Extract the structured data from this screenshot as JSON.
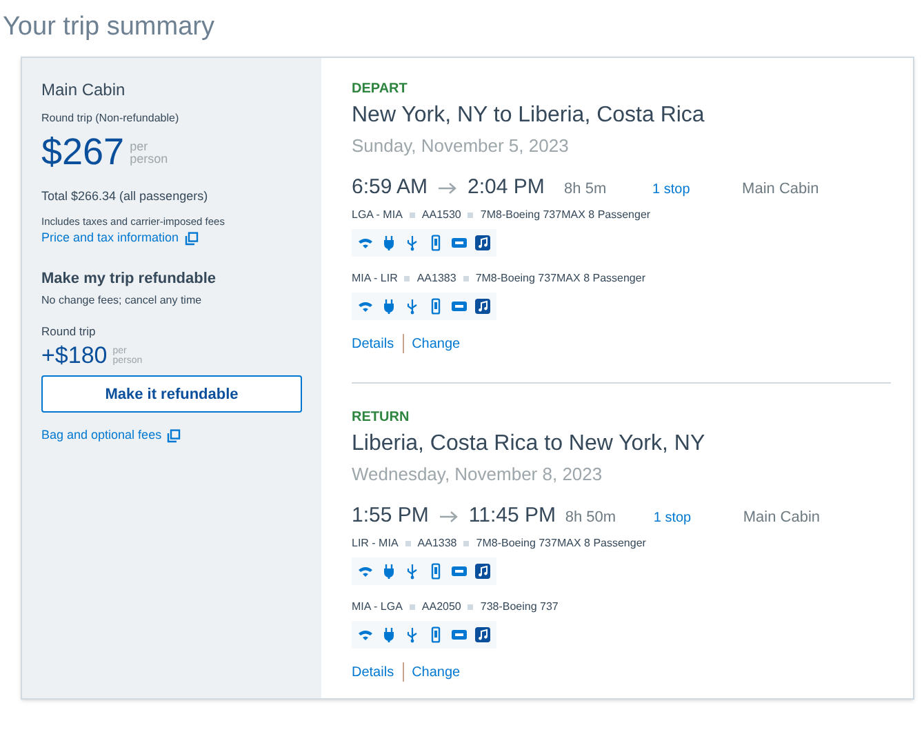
{
  "title": "Your trip summary",
  "fare": {
    "cabin": "Main Cabin",
    "type": "Round trip (Non-refundable)",
    "price": "$267",
    "per": "per",
    "person": "person",
    "total": "Total $266.34 (all passengers)",
    "includes": "Includes taxes and carrier-imposed fees",
    "price_link": "Price and tax information",
    "refund_title": "Make my trip refundable",
    "refund_note": "No change fees; cancel any time",
    "refund_label": "Round trip",
    "refund_price": "+$180",
    "refund_per": "per",
    "refund_person": "person",
    "refund_button": "Make it refundable",
    "bag_link": "Bag and optional fees"
  },
  "legs": [
    {
      "label": "DEPART",
      "route": "New York, NY to Liberia, Costa Rica",
      "date": "Sunday, November 5, 2023",
      "depart": "6:59 AM",
      "arrive": "2:04 PM",
      "duration": "8h 5m",
      "stops": "1 stop",
      "cabin": "Main Cabin",
      "segments": [
        {
          "airports": "LGA - MIA",
          "flight": "AA1530",
          "aircraft": "7M8-Boeing 737MAX 8 Passenger",
          "amenities": [
            {
              "kind": "wifi"
            },
            {
              "kind": "power"
            },
            {
              "kind": "usb"
            },
            {
              "kind": "phone"
            },
            {
              "kind": "tv"
            },
            {
              "kind": "music"
            }
          ]
        },
        {
          "airports": "MIA - LIR",
          "flight": "AA1383",
          "aircraft": "7M8-Boeing 737MAX 8 Passenger",
          "amenities": [
            {
              "kind": "wifi"
            },
            {
              "kind": "power"
            },
            {
              "kind": "usb"
            },
            {
              "kind": "phone"
            },
            {
              "kind": "tv"
            },
            {
              "kind": "music"
            }
          ]
        }
      ],
      "links": [
        "Details",
        "Change"
      ]
    },
    {
      "label": "RETURN",
      "route": "Liberia, Costa Rica to New York, NY",
      "date": "Wednesday, November 8, 2023",
      "depart": "1:55 PM",
      "arrive": "11:45 PM",
      "duration": "8h 50m",
      "stops": "1 stop",
      "cabin": "Main Cabin",
      "segments": [
        {
          "airports": "LIR - MIA",
          "flight": "AA1338",
          "aircraft": "7M8-Boeing 737MAX 8 Passenger",
          "amenities": [
            {
              "kind": "wifi"
            },
            {
              "kind": "power"
            },
            {
              "kind": "usb"
            },
            {
              "kind": "phone"
            },
            {
              "kind": "tv"
            },
            {
              "kind": "music"
            }
          ]
        },
        {
          "airports": "MIA - LGA",
          "flight": "AA2050",
          "aircraft": "738-Boeing 737",
          "amenities": [
            {
              "kind": "wifi"
            },
            {
              "kind": "power"
            },
            {
              "kind": "usb"
            },
            {
              "kind": "phone"
            },
            {
              "kind": "tv"
            },
            {
              "kind": "music"
            }
          ]
        }
      ],
      "links": [
        "Details",
        "Change"
      ]
    }
  ]
}
